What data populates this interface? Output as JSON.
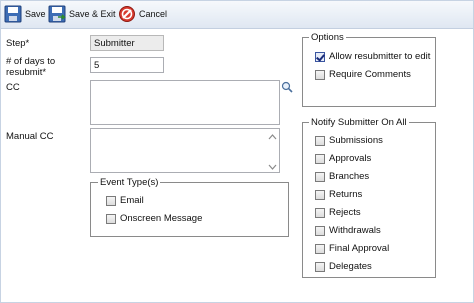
{
  "toolbar": {
    "save_label": "Save",
    "save_exit_label": "Save & Exit",
    "cancel_label": "Cancel"
  },
  "form": {
    "step_label": "Step*",
    "step_value": "Submitter",
    "days_label_line1": "# of days to",
    "days_label_line2": "resubmit*",
    "days_value": "5",
    "cc_label": "CC",
    "manual_cc_label": "Manual CC"
  },
  "event_types": {
    "title": "Event Type(s)",
    "items": [
      {
        "label": "Email",
        "checked": false
      },
      {
        "label": "Onscreen Message",
        "checked": false
      }
    ]
  },
  "options": {
    "title": "Options",
    "items": [
      {
        "label": "Allow resubmitter to edit",
        "checked": true
      },
      {
        "label": "Require Comments",
        "checked": false
      }
    ]
  },
  "notify": {
    "title": "Notify Submitter On All",
    "items": [
      {
        "label": "Submissions",
        "checked": false
      },
      {
        "label": "Approvals",
        "checked": false
      },
      {
        "label": "Branches",
        "checked": false
      },
      {
        "label": "Returns",
        "checked": false
      },
      {
        "label": "Rejects",
        "checked": false
      },
      {
        "label": "Withdrawals",
        "checked": false
      },
      {
        "label": "Final Approval",
        "checked": false
      },
      {
        "label": "Delegates",
        "checked": false
      }
    ]
  },
  "icons": {
    "save": "floppy-disk-icon",
    "save_exit": "floppy-disk-exit-icon",
    "cancel": "cancel-icon",
    "search": "magnifier-icon"
  }
}
